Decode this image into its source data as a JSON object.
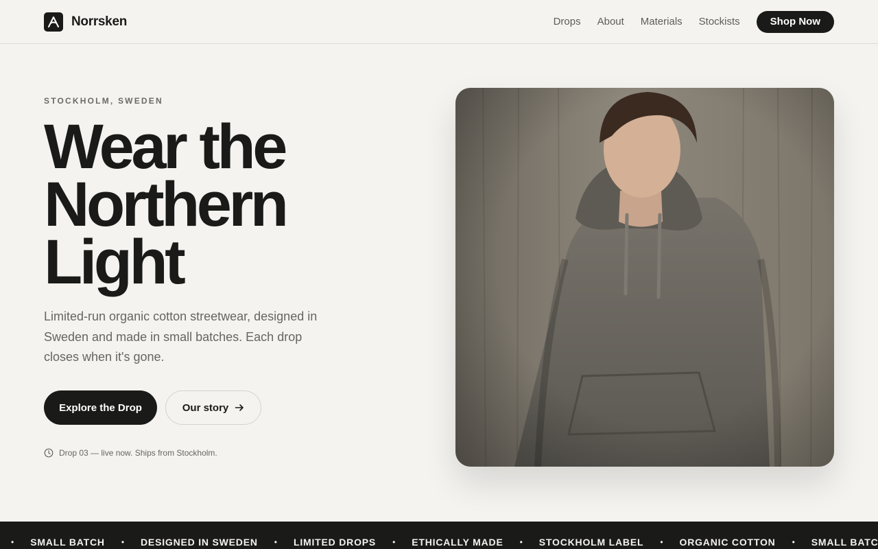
{
  "brand": {
    "name": "Norrsken"
  },
  "nav": {
    "links": [
      "Drops",
      "About",
      "Materials",
      "Stockists"
    ],
    "cta": "Shop Now"
  },
  "hero": {
    "eyebrow": "STOCKHOLM, SWEDEN",
    "headline": [
      "Wear the",
      "Northern",
      "Light"
    ],
    "lede": "Limited-run organic cotton streetwear, designed in Sweden and made in small batches. Each drop closes when it's gone.",
    "primary_cta": "Explore the Drop",
    "secondary_cta": "Our story",
    "status": "Drop 03 — live now. Ships from Stockholm."
  },
  "marquee": {
    "items": [
      "SMALL BATCH",
      "DESIGNED IN SWEDEN",
      "LIMITED DROPS",
      "ETHICALLY MADE",
      "STOCKHOLM LABEL",
      "ORGANIC COTTON",
      "SMALL BATCH"
    ],
    "separator": "•"
  },
  "colors": {
    "background": "#f4f3f0",
    "ink": "#1a1a18",
    "muted": "#66655f",
    "hoodie": "#6b6760",
    "wall": "#8a8378"
  },
  "icons": {
    "logo": "logo-mark-icon",
    "status": "clock-icon",
    "cta_arrow": "arrow-right-icon"
  }
}
